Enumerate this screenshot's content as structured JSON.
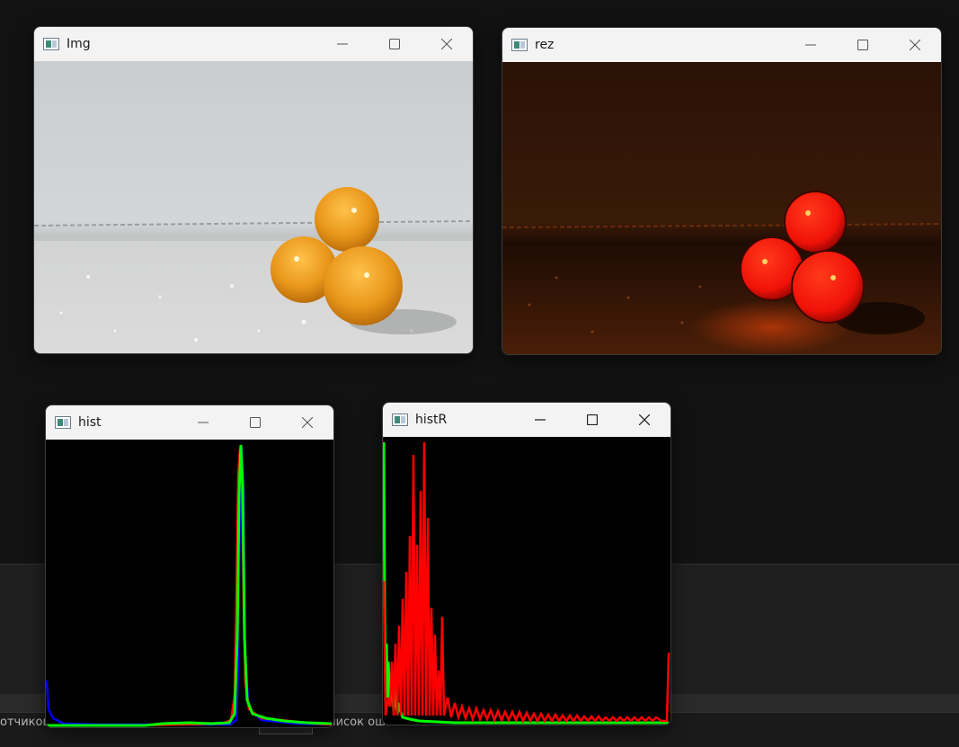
{
  "windows": {
    "img": {
      "title": "Img"
    },
    "rez": {
      "title": "rez"
    },
    "hist": {
      "title": "hist"
    },
    "histR": {
      "title": "histR"
    }
  },
  "ide": {
    "tabs": [
      {
        "label": "отчиков"
      },
      {
        "label": "Список ошибок"
      }
    ]
  },
  "colors": {
    "titlebar": "#f3f3f3",
    "hist_blue": "#0000ff",
    "hist_green": "#00ff00",
    "hist_red": "#ff0000",
    "berry_orange": "#e89a1a",
    "berry_red": "#ff1a0a"
  },
  "icons": {
    "app": "opencv-window-icon",
    "minimize": "minimize-icon",
    "maximize": "maximize-icon",
    "close": "close-icon"
  }
}
